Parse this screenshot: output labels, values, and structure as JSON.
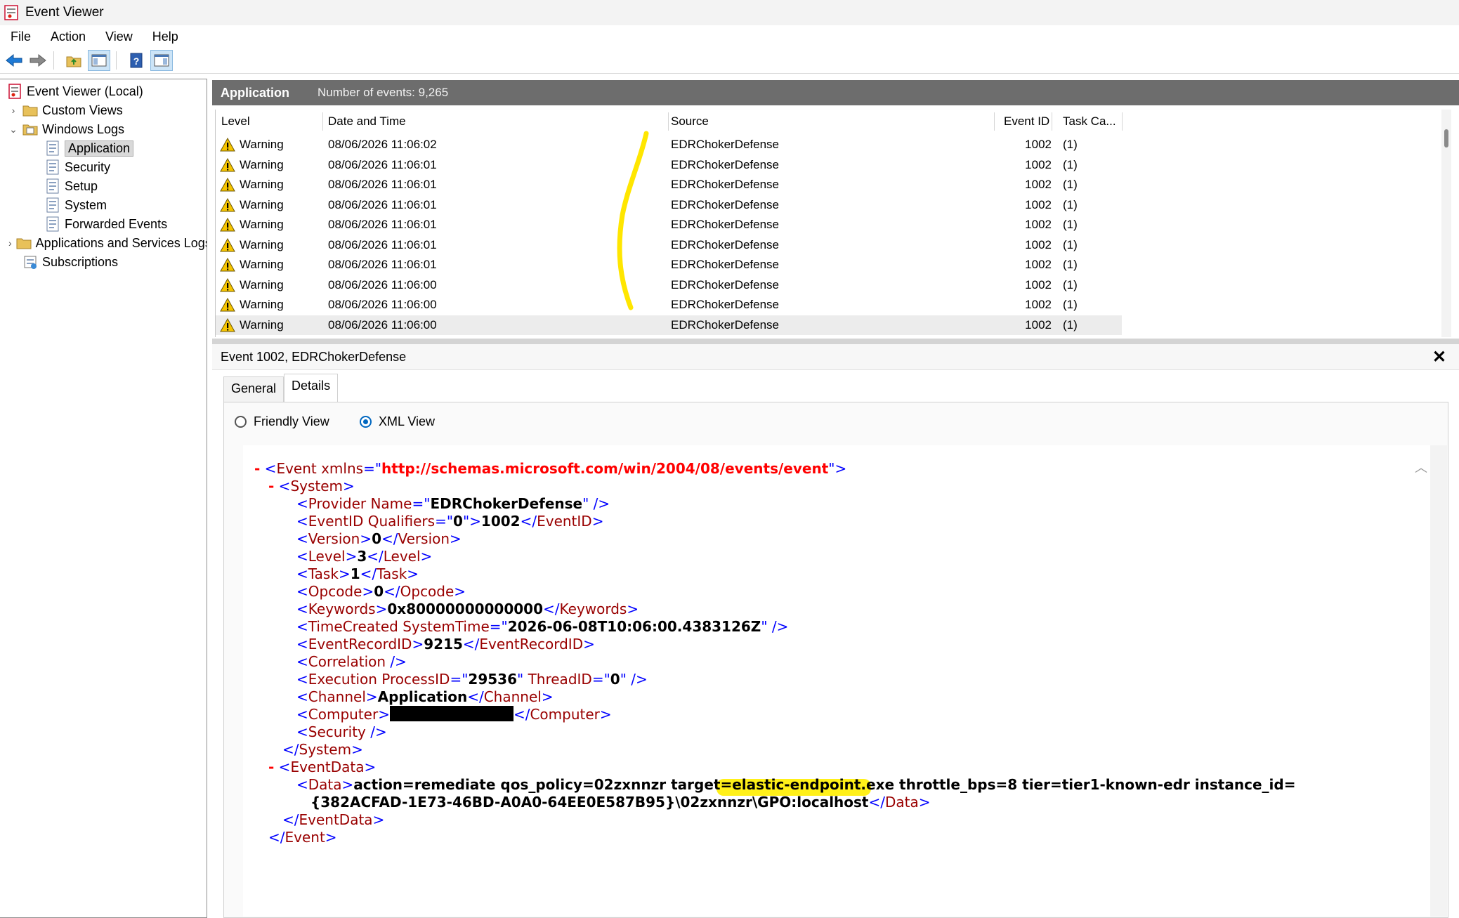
{
  "window": {
    "title": "Event Viewer"
  },
  "menu": [
    "File",
    "Action",
    "View",
    "Help"
  ],
  "toolbar": {
    "icons": [
      "back-arrow-icon",
      "forward-arrow-icon",
      "folder-up-icon",
      "show-hide-tree-icon",
      "help-icon",
      "action-pane-icon"
    ]
  },
  "tree": {
    "root": "Event Viewer (Local)",
    "custom_views": "Custom Views",
    "windows_logs": "Windows Logs",
    "logs": [
      "Application",
      "Security",
      "Setup",
      "System",
      "Forwarded Events"
    ],
    "apps_services": "Applications and Services Logs",
    "subscriptions": "Subscriptions",
    "selected": "Application"
  },
  "log_header": {
    "name": "Application",
    "count": "Number of events: 9,265"
  },
  "grid": {
    "columns": [
      "Level",
      "Date and Time",
      "Source",
      "Event ID",
      "Task Ca..."
    ],
    "rows": [
      {
        "level": "Warning",
        "datetime": "08/06/2026 11:06:02",
        "source": "EDRChokerDefense",
        "event_id": "1002",
        "task": "(1)"
      },
      {
        "level": "Warning",
        "datetime": "08/06/2026 11:06:01",
        "source": "EDRChokerDefense",
        "event_id": "1002",
        "task": "(1)"
      },
      {
        "level": "Warning",
        "datetime": "08/06/2026 11:06:01",
        "source": "EDRChokerDefense",
        "event_id": "1002",
        "task": "(1)"
      },
      {
        "level": "Warning",
        "datetime": "08/06/2026 11:06:01",
        "source": "EDRChokerDefense",
        "event_id": "1002",
        "task": "(1)"
      },
      {
        "level": "Warning",
        "datetime": "08/06/2026 11:06:01",
        "source": "EDRChokerDefense",
        "event_id": "1002",
        "task": "(1)"
      },
      {
        "level": "Warning",
        "datetime": "08/06/2026 11:06:01",
        "source": "EDRChokerDefense",
        "event_id": "1002",
        "task": "(1)"
      },
      {
        "level": "Warning",
        "datetime": "08/06/2026 11:06:01",
        "source": "EDRChokerDefense",
        "event_id": "1002",
        "task": "(1)"
      },
      {
        "level": "Warning",
        "datetime": "08/06/2026 11:06:00",
        "source": "EDRChokerDefense",
        "event_id": "1002",
        "task": "(1)"
      },
      {
        "level": "Warning",
        "datetime": "08/06/2026 11:06:00",
        "source": "EDRChokerDefense",
        "event_id": "1002",
        "task": "(1)"
      },
      {
        "level": "Warning",
        "datetime": "08/06/2026 11:06:00",
        "source": "EDRChokerDefense",
        "event_id": "1002",
        "task": "(1)"
      }
    ],
    "selected_row": 9
  },
  "details": {
    "title": "Event 1002, EDRChokerDefense",
    "close_glyph": "✕",
    "tabs": [
      "General",
      "Details"
    ],
    "active_tab": "Details",
    "views": [
      "Friendly View",
      "XML View"
    ],
    "selected_view": "XML View"
  },
  "xml": {
    "collapse": "-",
    "event_tag": "Event",
    "xmlns_attr": "xmlns",
    "xmlns_value": "http://schemas.microsoft.com/win/2004/08/events/event",
    "system_tag": "System",
    "provider_tag": "Provider",
    "provider_attr": "Name",
    "provider_name": "EDRChokerDefense",
    "eventid_tag": "EventID",
    "eventid_attr": "Qualifiers",
    "eventid_qualifiers": "0",
    "eventid": "1002",
    "version_tag": "Version",
    "version": "0",
    "level_tag": "Level",
    "level": "3",
    "task_tag": "Task",
    "task": "1",
    "opcode_tag": "Opcode",
    "opcode": "0",
    "keywords_tag": "Keywords",
    "keywords": "0x80000000000000",
    "timecreated_tag": "TimeCreated",
    "timecreated_attr": "SystemTime",
    "time_created": "2026-06-08T10:06:00.4383126Z",
    "recordid_tag": "EventRecordID",
    "record_id": "9215",
    "correlation_tag": "Correlation",
    "execution_tag": "Execution",
    "process_attr": "ProcessID",
    "process_id": "29536",
    "thread_attr": "ThreadID",
    "thread_id": "0",
    "channel_tag": "Channel",
    "channel": "Application",
    "computer_tag": "Computer",
    "security_tag": "Security",
    "eventdata_tag": "EventData",
    "data_tag": "Data",
    "data_line1_a": "action=remediate qos_policy=02zxnnzr target=",
    "data_highlight": "elastic-endpoint.exe",
    "data_line1_b": " throttle_bps=8 tier=tier1-known-edr instance_id=",
    "data_line2": "{382ACFAD-1E73-46BD-A0A0-64EE0E587B95}\\02zxnnzr\\GPO:localhost"
  },
  "colors": {
    "markup": "#0000ff",
    "tag": "#990000",
    "attr_value": "#ff0000",
    "highlight": "#ffee00",
    "header_bg": "#6d6d6d"
  }
}
